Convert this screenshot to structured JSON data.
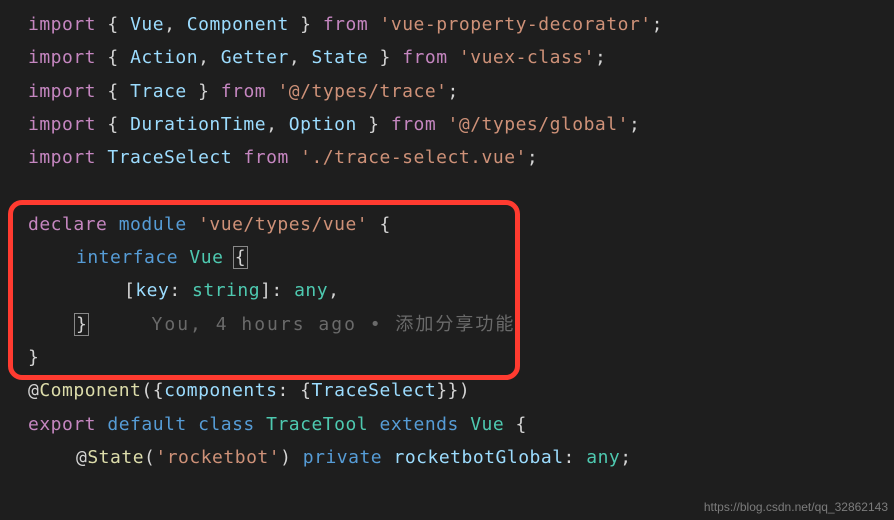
{
  "code": {
    "l1": {
      "kw1": "import",
      "b1": "{ ",
      "v1": "Vue",
      "c1": ", ",
      "v2": "Component",
      "b2": " }",
      "kw2": " from ",
      "str": "'vue-property-decorator'",
      "end": ";"
    },
    "l2": {
      "kw1": "import",
      "b1": "{ ",
      "v1": "Action",
      "c1": ", ",
      "v2": "Getter",
      "c2": ", ",
      "v3": "State",
      "b2": " }",
      "kw2": " from ",
      "str": "'vuex-class'",
      "end": ";"
    },
    "l3": {
      "kw1": "import",
      "b1": "{ ",
      "v1": "Trace",
      "b2": " }",
      "kw2": " from ",
      "str": "'@/types/trace'",
      "end": ";"
    },
    "l4": {
      "kw1": "import",
      "b1": "{ ",
      "v1": "DurationTime",
      "c1": ", ",
      "v2": "Option",
      "b2": " }",
      "kw2": " from ",
      "str": "'@/types/global'",
      "end": ";"
    },
    "l5": {
      "kw1": "import",
      "sp": " ",
      "v1": "TraceSelect",
      "kw2": " from ",
      "str": "'./trace-select.vue'",
      "end": ";"
    },
    "blank": "",
    "l7": {
      "kw1": "declare",
      "sp": " ",
      "kw2": "module",
      "sp2": " ",
      "str": "'vue/types/vue'",
      "b": " {"
    },
    "l8": {
      "kw1": "interface",
      "sp": " ",
      "type": "Vue",
      "sp2": " ",
      "b": "{"
    },
    "l9": {
      "b1": "[",
      "v1": "key",
      "c": ": ",
      "t": "string",
      "b2": "]: ",
      "t2": "any",
      "end": ","
    },
    "l10": {
      "b": "}",
      "blame": "     You, 4 hours ago • 添加分享功能"
    },
    "l11": {
      "b": "}"
    },
    "l12": {
      "at": "@",
      "fn": "Component",
      "p1": "({",
      "v1": "components",
      "c": ": {",
      "v2": "TraceSelect",
      "p2": "}})"
    },
    "l13": {
      "kw1": "export",
      "sp": " ",
      "kw2": "default",
      "sp2": " ",
      "kw3": "class",
      "sp3": " ",
      "type": "TraceTool",
      "sp4": " ",
      "kw4": "extends",
      "sp5": " ",
      "type2": "Vue",
      "b": " {"
    },
    "l14": {
      "at": "@",
      "fn": "State",
      "p1": "(",
      "str": "'rocketbot'",
      "p2": ") ",
      "kw": "private",
      "sp": " ",
      "v": "rocketbotGlobal",
      "c": ": ",
      "t": "any",
      "end": ";"
    }
  },
  "watermark": "https://blog.csdn.net/qq_32862143"
}
